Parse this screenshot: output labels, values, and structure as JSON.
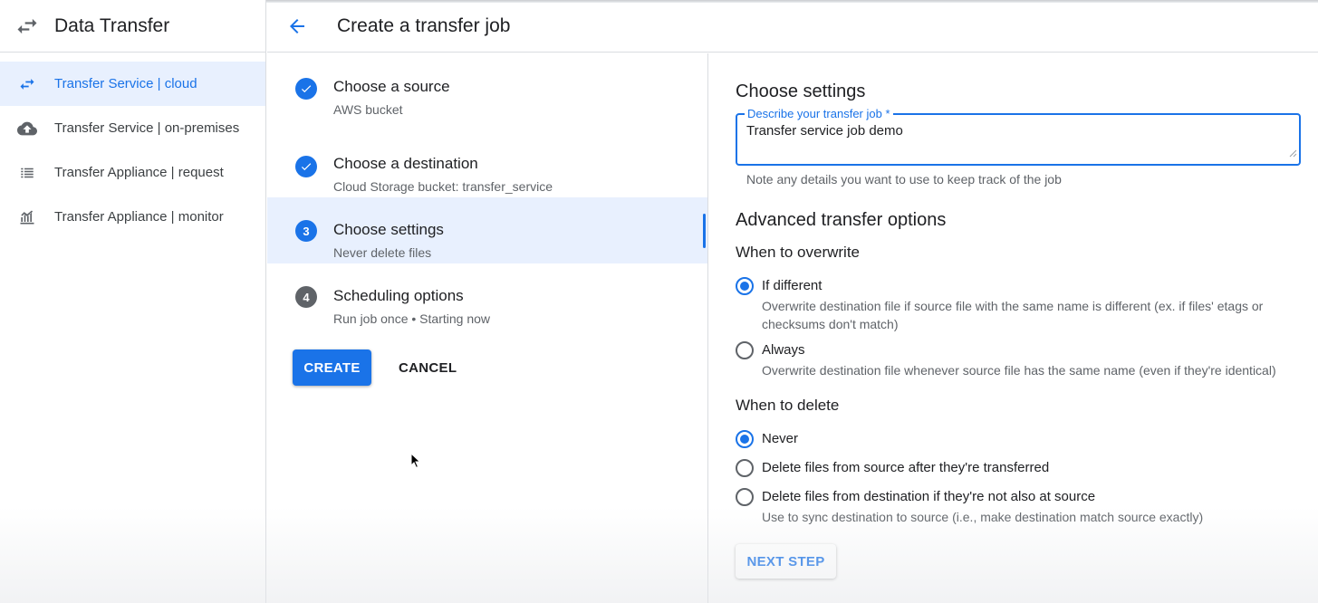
{
  "app": {
    "title": "Data Transfer",
    "logo_icon": "swap-arrows-icon"
  },
  "sidebar": {
    "items": [
      {
        "label": "Transfer Service | cloud",
        "icon": "swap-arrows-icon",
        "active": true
      },
      {
        "label": "Transfer Service | on-premises",
        "icon": "cloud-upload-icon",
        "active": false
      },
      {
        "label": "Transfer Appliance | request",
        "icon": "list-icon",
        "active": false
      },
      {
        "label": "Transfer Appliance | monitor",
        "icon": "monitor-chart-icon",
        "active": false
      }
    ]
  },
  "header": {
    "title": "Create a transfer job",
    "back_icon": "arrow-back-icon"
  },
  "steps": [
    {
      "title": "Choose a source",
      "subtitle": "AWS bucket",
      "status": "done"
    },
    {
      "title": "Choose a destination",
      "subtitle": "Cloud Storage bucket: transfer_service",
      "status": "done"
    },
    {
      "number": "3",
      "title": "Choose settings",
      "subtitle": "Never delete files",
      "status": "current"
    },
    {
      "number": "4",
      "title": "Scheduling options",
      "subtitle": "Run job once • Starting now",
      "status": "pending"
    }
  ],
  "actions": {
    "create_label": "CREATE",
    "cancel_label": "CANCEL"
  },
  "settings": {
    "heading": "Choose settings",
    "description_field": {
      "label": "Describe your transfer job *",
      "value": "Transfer service job demo",
      "hint": "Note any details you want to use to keep track of the job"
    },
    "advanced_heading": "Advanced transfer options",
    "overwrite": {
      "heading": "When to overwrite",
      "options": [
        {
          "label": "If different",
          "description": "Overwrite destination file if source file with the same name is different (ex. if files' etags or checksums don't match)",
          "selected": true
        },
        {
          "label": "Always",
          "description": "Overwrite destination file whenever source file has the same name (even if they're identical)",
          "selected": false
        }
      ]
    },
    "delete": {
      "heading": "When to delete",
      "options": [
        {
          "label": "Never",
          "description": "",
          "selected": true
        },
        {
          "label": "Delete files from source after they're transferred",
          "description": "",
          "selected": false
        },
        {
          "label": "Delete files from destination if they're not also at source",
          "description": "Use to sync destination to source (i.e., make destination match source exactly)",
          "selected": false
        }
      ]
    },
    "next_label": "NEXT STEP"
  },
  "colors": {
    "accent": "#1a73e8",
    "active_bg": "#e8f0fe",
    "text": "#202124",
    "secondary_text": "#5f6368"
  }
}
